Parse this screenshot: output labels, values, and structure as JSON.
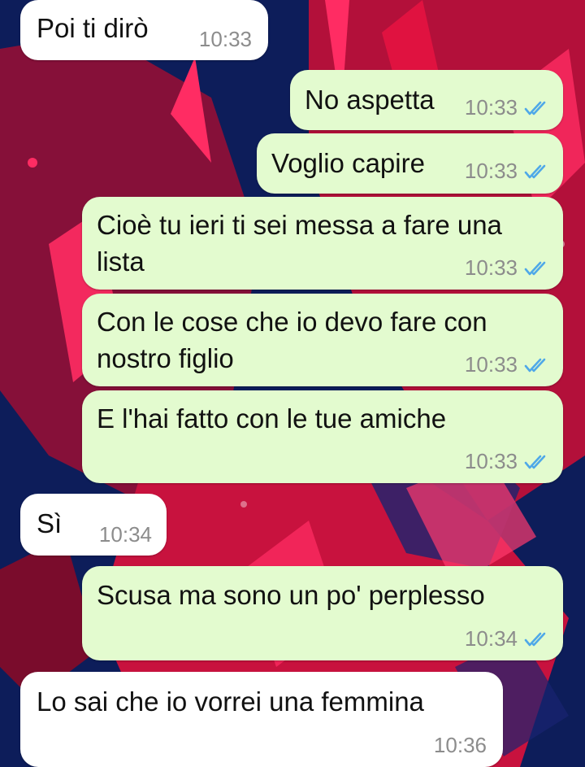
{
  "theme": {
    "incoming_bubble": "#ffffff",
    "outgoing_bubble": "#e3fbcf",
    "read_receipt": "#4fa8e8",
    "wallpaper_dark": "#0d1d5a",
    "wallpaper_red": "#e01240",
    "wallpaper_pink": "#ff2c63"
  },
  "messages": [
    {
      "dir": "in",
      "text": "Poi ti dirò",
      "time": "10:33"
    },
    {
      "dir": "out",
      "text": "No aspetta",
      "time": "10:33",
      "status": "read-double-check-icon"
    },
    {
      "dir": "out",
      "text": "Voglio capire",
      "time": "10:33",
      "status": "read-double-check-icon"
    },
    {
      "dir": "out",
      "text": "Cioè tu ieri ti sei messa a fare una\nlista",
      "time": "10:33",
      "status": "read-double-check-icon"
    },
    {
      "dir": "out",
      "text": "Con le cose che io devo fare con\nnostro figlio",
      "time": "10:33",
      "status": "read-double-check-icon"
    },
    {
      "dir": "out",
      "text": "E l'hai fatto con le tue amiche",
      "time": "10:33",
      "status": "read-double-check-icon"
    },
    {
      "dir": "in",
      "text": "Sì",
      "time": "10:34"
    },
    {
      "dir": "out",
      "text": "Scusa ma sono un po' perplesso",
      "time": "10:34",
      "status": "read-double-check-icon"
    },
    {
      "dir": "in",
      "text": "Lo sai che io vorrei una femmina",
      "time": "10:36"
    }
  ]
}
